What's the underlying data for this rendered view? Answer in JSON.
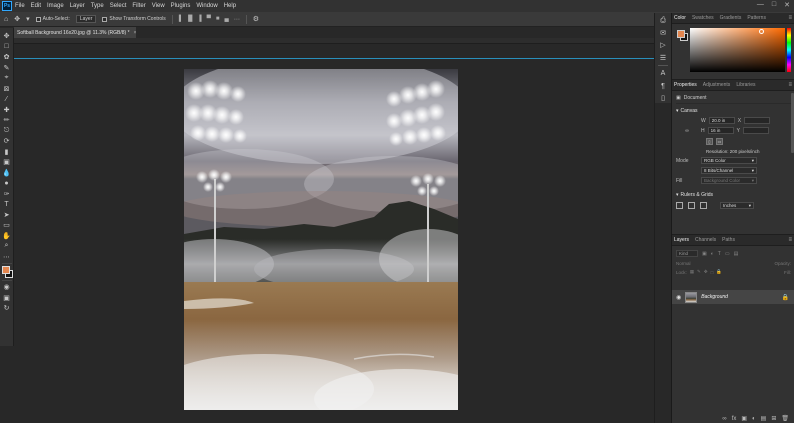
{
  "menubar": {
    "logo": "Ps",
    "items": [
      "File",
      "Edit",
      "Image",
      "Layer",
      "Type",
      "Select",
      "Filter",
      "View",
      "Plugins",
      "Window",
      "Help"
    ]
  },
  "options": {
    "auto_select_label": "Auto-Select:",
    "auto_select_value": "Layer",
    "transform_controls_label": "Show Transform Controls"
  },
  "document": {
    "tab_title": "Softball Background 16x20.jpg @ 11.3% (RGB/8) *",
    "close_glyph": "×"
  },
  "colors": {
    "foreground": "#e3864f",
    "background": "#111111",
    "guide": "#29a9e0"
  },
  "color_panel": {
    "tabs": [
      "Color",
      "Swatches",
      "Gradients",
      "Patterns"
    ]
  },
  "properties_panel": {
    "tabs": [
      "Properties",
      "Adjustments",
      "Libraries"
    ],
    "doc_label": "Document",
    "canvas_section": "Canvas",
    "w_label": "W",
    "w_value": "20.0 in",
    "h_label": "H",
    "h_value": "16 in",
    "x_label": "X",
    "y_label": "Y",
    "resolution": "Resolution: 200 pixels/inch",
    "mode_label": "Mode",
    "mode_value": "RGB Color",
    "depth_value": "8 Bits/Channel",
    "fill_label": "Fill",
    "fill_value": "Background Color",
    "rulers_section": "Rulers & Grids",
    "units_value": "Inches"
  },
  "layers_panel": {
    "tabs": [
      "Layers",
      "Channels",
      "Paths"
    ],
    "kind_placeholder": "Kind",
    "blend_mode": "Normal",
    "opacity_label": "Opacity:",
    "lock_label": "Lock:",
    "fill_label": "Fill:",
    "layer_name": "Background"
  }
}
